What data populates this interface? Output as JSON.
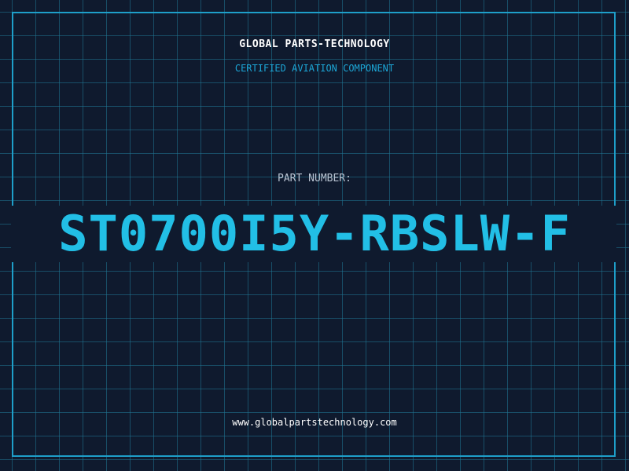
{
  "header": {
    "company": "GLOBAL PARTS-TECHNOLOGY",
    "subtitle": "CERTIFIED AVIATION COMPONENT"
  },
  "part": {
    "label": "PART NUMBER:",
    "number": "ST0700I5Y-RBSLW-F"
  },
  "footer": {
    "website": "www.globalpartstechnology.com"
  },
  "colors": {
    "background": "#0f1a2e",
    "grid": "#20788f",
    "accent": "#22bfe6",
    "label": "#b9c4d2",
    "text": "#ffffff"
  }
}
